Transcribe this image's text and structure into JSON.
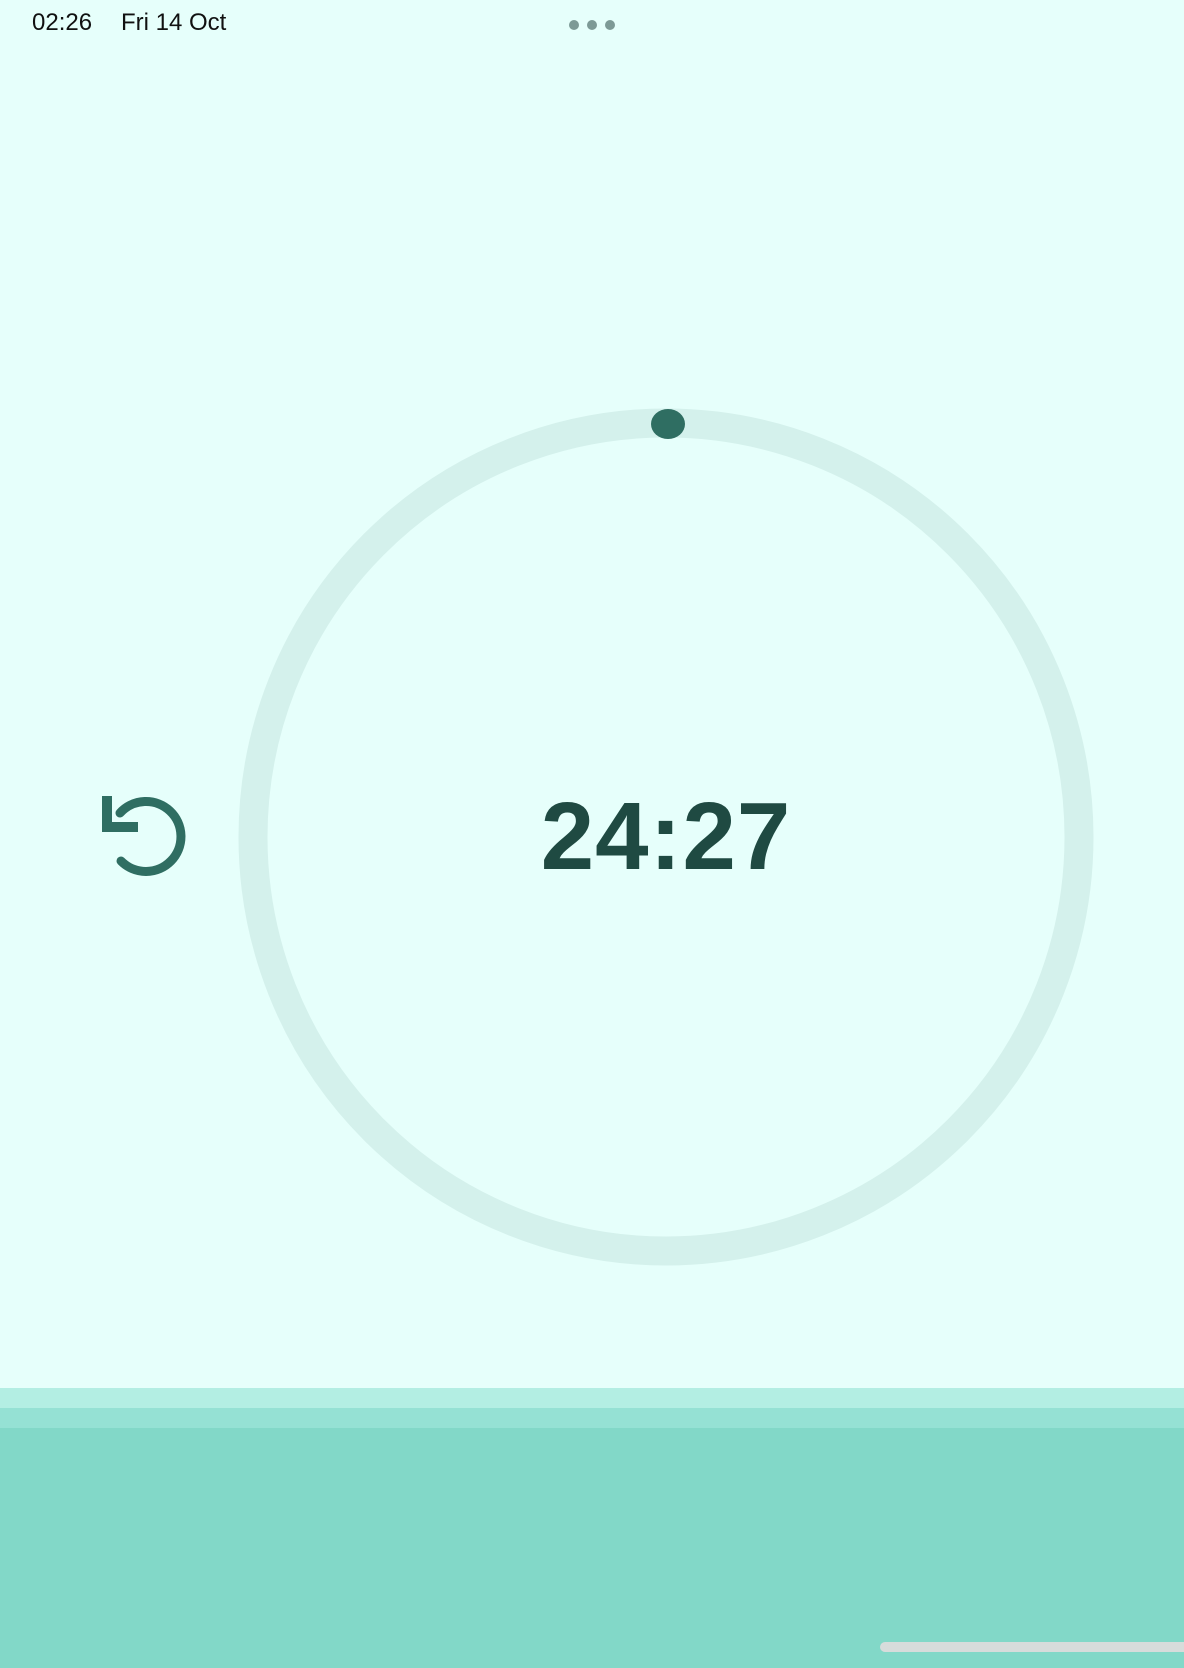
{
  "status_bar": {
    "time": "02:26",
    "date": "Fri 14 Oct"
  },
  "timer": {
    "remaining": "24:27",
    "progress": 0.0
  },
  "icons": {
    "reset": "reset-icon",
    "multitask": "more-dots-icon"
  },
  "colors": {
    "background": "#e6fffb",
    "ring_track": "#d4f1ec",
    "accent": "#2f6e62",
    "text": "#1f4a42",
    "wave_light": "#b3eee3",
    "wave_mid": "#95e1d4",
    "wave_base": "#82d8c8"
  }
}
